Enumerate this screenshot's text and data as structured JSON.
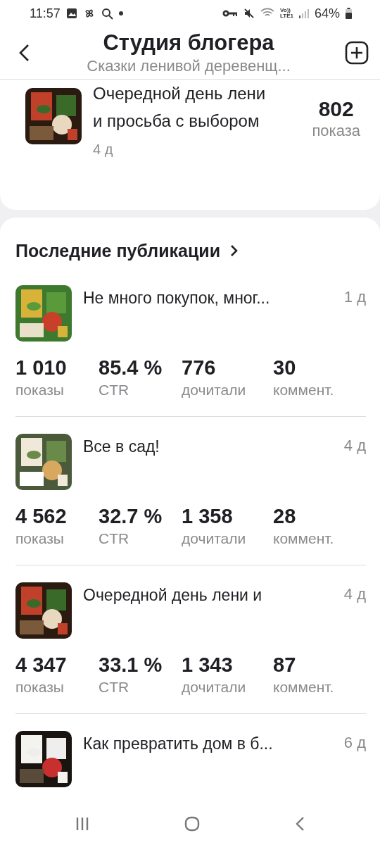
{
  "status_bar": {
    "time": "11:57",
    "volte": "Vo))",
    "lte": "LTE1",
    "battery": "64%"
  },
  "header": {
    "title": "Студия блогера",
    "subtitle": "Сказки ленивой деревенщ..."
  },
  "top_post": {
    "title": "Очередной день лени и просьба с выбором",
    "age": "4 д",
    "views": "802",
    "views_label": "показа"
  },
  "section": {
    "title": "Последние публикации"
  },
  "publications": [
    {
      "title": "Не много покупок, мног...",
      "age": "1 д",
      "stats": [
        {
          "value": "1 010",
          "label": "показы"
        },
        {
          "value": "85.4 %",
          "label": "CTR"
        },
        {
          "value": "776",
          "label": "дочитали"
        },
        {
          "value": "30",
          "label": "коммент."
        }
      ]
    },
    {
      "title": "Все в сад!",
      "age": "4 д",
      "stats": [
        {
          "value": "4 562",
          "label": "показы"
        },
        {
          "value": "32.7 %",
          "label": "CTR"
        },
        {
          "value": "1 358",
          "label": "дочитали"
        },
        {
          "value": "28",
          "label": "коммент."
        }
      ]
    },
    {
      "title": "Очередной день лени и",
      "age": "4 д",
      "stats": [
        {
          "value": "4 347",
          "label": "показы"
        },
        {
          "value": "33.1 %",
          "label": "CTR"
        },
        {
          "value": "1 343",
          "label": "дочитали"
        },
        {
          "value": "87",
          "label": "коммент."
        }
      ]
    },
    {
      "title": "Как превратить дом в б...",
      "age": "6 д"
    }
  ]
}
